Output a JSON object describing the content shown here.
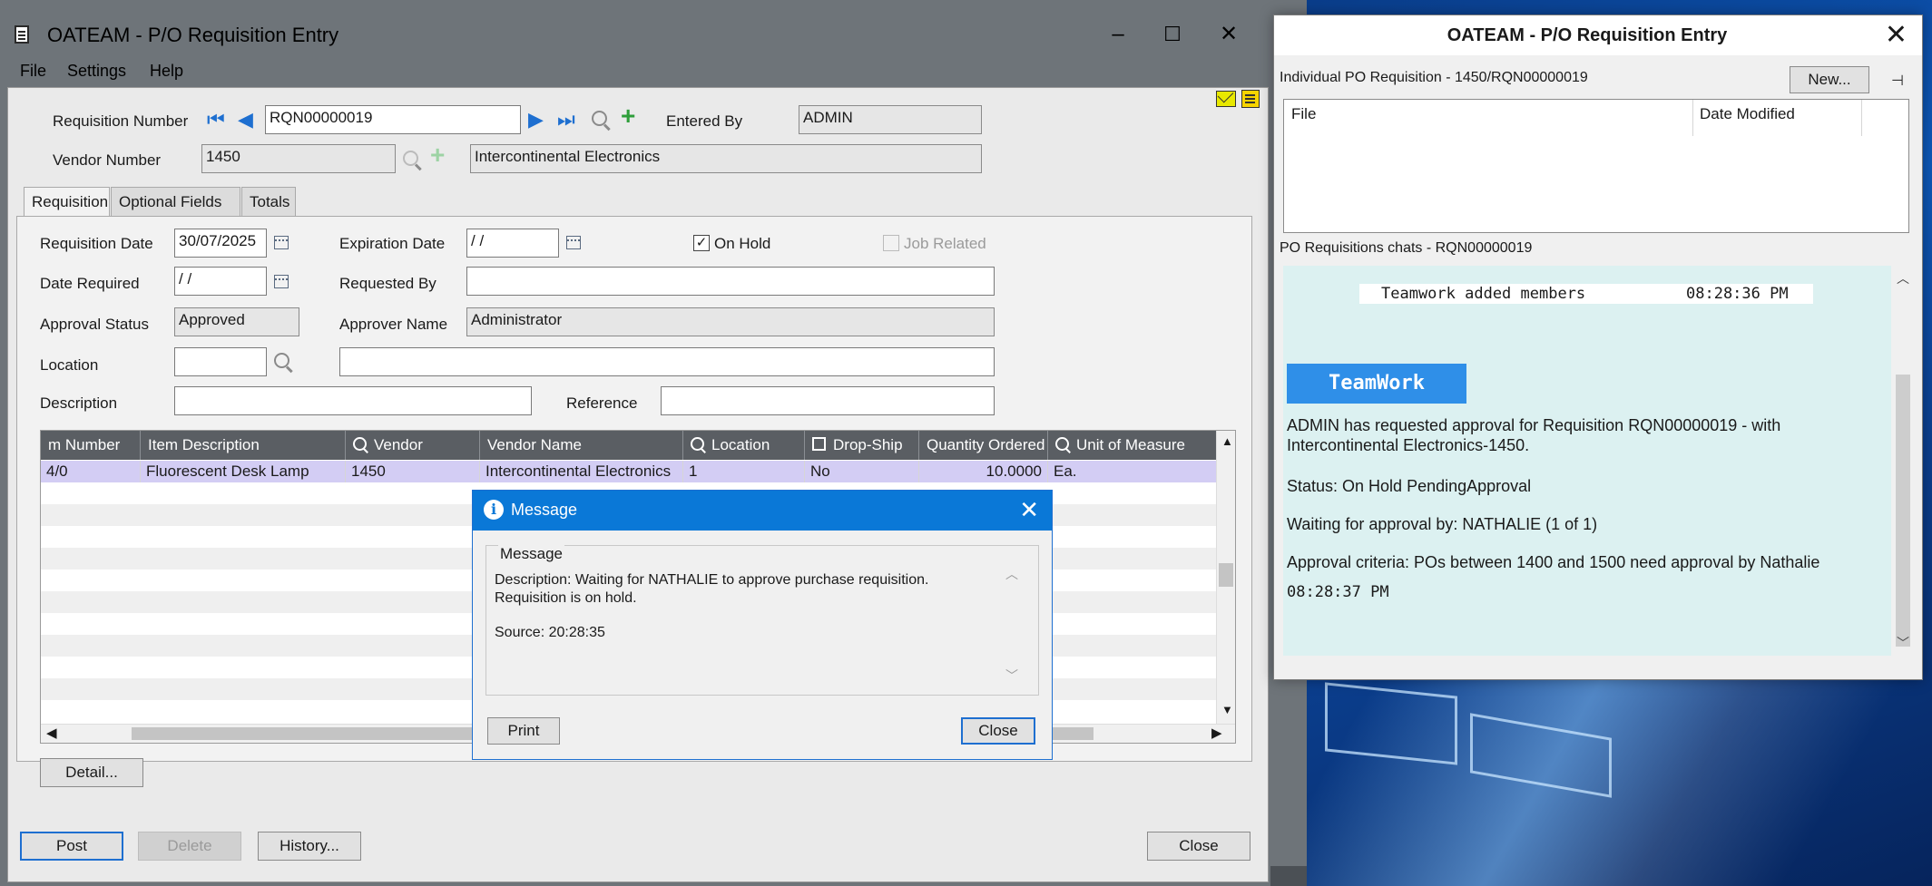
{
  "main_window": {
    "title": "OATEAM - P/O Requisition Entry",
    "menu": [
      "File",
      "Settings",
      "Help"
    ],
    "window_controls": {
      "minimize": "–",
      "maximize": "☐",
      "close": "✕"
    }
  },
  "header": {
    "requisition_number_label": "Requisition Number",
    "requisition_number": "RQN00000019",
    "entered_by_label": "Entered By",
    "entered_by": "ADMIN",
    "vendor_number_label": "Vendor Number",
    "vendor_number": "1450",
    "vendor_name": "Intercontinental Electronics"
  },
  "tabs": [
    "Requisition",
    "Optional Fields",
    "Totals"
  ],
  "requisition_tab": {
    "requisition_date_label": "Requisition Date",
    "requisition_date": "30/07/2025",
    "expiration_date_label": "Expiration Date",
    "expiration_date": " / /",
    "on_hold_label": "On Hold",
    "on_hold_checked": true,
    "job_related_label": "Job Related",
    "date_required_label": "Date Required",
    "date_required": " / /",
    "requested_by_label": "Requested By",
    "requested_by": "",
    "approval_status_label": "Approval Status",
    "approval_status": "Approved",
    "approver_name_label": "Approver Name",
    "approver_name": "Administrator",
    "location_label": "Location",
    "location": "",
    "location_desc": "",
    "description_label": "Description",
    "description": "",
    "reference_label": "Reference",
    "reference": ""
  },
  "grid": {
    "columns": [
      "m Number",
      "Item Description",
      "Vendor",
      "Vendor Name",
      "Location",
      "Drop-Ship",
      "Quantity Ordered",
      "Unit of Measure"
    ],
    "rows": [
      [
        "4/0",
        "Fluorescent Desk Lamp",
        "1450",
        "Intercontinental Electronics",
        "1",
        "No",
        "10.0000",
        "Ea."
      ]
    ]
  },
  "buttons": {
    "detail": "Detail...",
    "post": "Post",
    "delete": "Delete",
    "history": "History...",
    "close": "Close"
  },
  "message_dialog": {
    "title": "Message",
    "group_label": "Message",
    "description": "Description: Waiting for NATHALIE to approve purchase requisition. Requisition is on hold.",
    "source": "Source:  20:28:35",
    "print": "Print",
    "close": "Close"
  },
  "side_panel": {
    "title": "OATEAM - P/O Requisition Entry",
    "individual_label": "Individual PO Requisition - 1450/RQN00000019",
    "new_button": "New...",
    "file_columns": [
      "File",
      "Date Modified"
    ],
    "chats_label": "PO Requisitions chats - RQN00000019",
    "chat": {
      "system_message": "Teamwork added members",
      "system_time": "08:28:36 PM",
      "sender": "TeamWork",
      "line1": "ADMIN has requested approval for Requisition RQN00000019 -  with Intercontinental Electronics-1450.",
      "line2": "Status: On Hold PendingApproval",
      "line3": "Waiting for approval by: NATHALIE (1 of 1)",
      "line4": "Approval criteria: POs between 1400 and 1500 need approval by Nathalie",
      "time": "08:28:37 PM"
    }
  }
}
